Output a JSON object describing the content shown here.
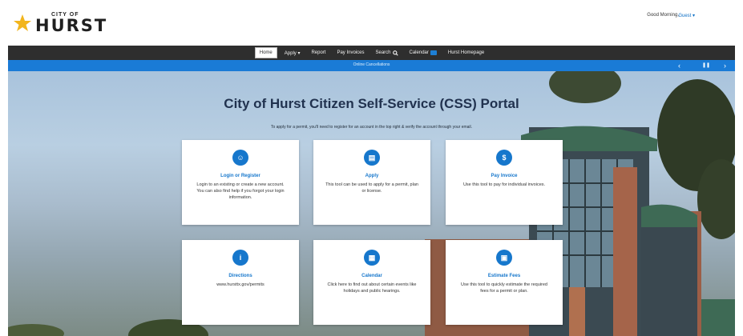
{
  "header": {
    "logo_small": "CITY OF",
    "logo_big": "HURST",
    "greeting": "Good Morning,",
    "user": "Guest ▾"
  },
  "nav": [
    {
      "label": "Home",
      "active": true
    },
    {
      "label": "Apply ▾"
    },
    {
      "label": "Report"
    },
    {
      "label": "Pay Invoices"
    },
    {
      "label": "Search"
    },
    {
      "label": "Calendar"
    },
    {
      "label": "Hurst Homepage"
    }
  ],
  "banner": {
    "text": "Online Cancellations",
    "prev": "‹",
    "pause": "❚❚",
    "next": "›"
  },
  "hero": {
    "title": "City of Hurst Citizen Self-Service (CSS) Portal",
    "subtitle": "To apply for a permit, you'll need to register for an account in the top right & verify the account through your email."
  },
  "cards": [
    {
      "title": "Login or Register",
      "description": "Login to an existing or create a new account. You can also find help if you forgot your login information.",
      "icon": "user-icon"
    },
    {
      "title": "Apply",
      "description": "This tool can be used to apply for a permit, plan or license.",
      "icon": "clipboard-icon"
    },
    {
      "title": "Pay Invoice",
      "description": "Use this tool to pay for individual invoices.",
      "icon": "dollar-icon"
    },
    {
      "title": "Directions",
      "description": "www.hursttx.gov/permits",
      "icon": "info-icon"
    },
    {
      "title": "Calendar",
      "description": "Click here to find out about certain events like holidays and public hearings.",
      "icon": "calendar-icon"
    },
    {
      "title": "Estimate Fees",
      "description": "Use this tool to quickly estimate the required fees for a permit or plan.",
      "icon": "calculator-icon"
    }
  ],
  "colors": {
    "accent": "#1677cc",
    "navbar": "#2e2e2e",
    "banner": "#1a7bd6"
  }
}
